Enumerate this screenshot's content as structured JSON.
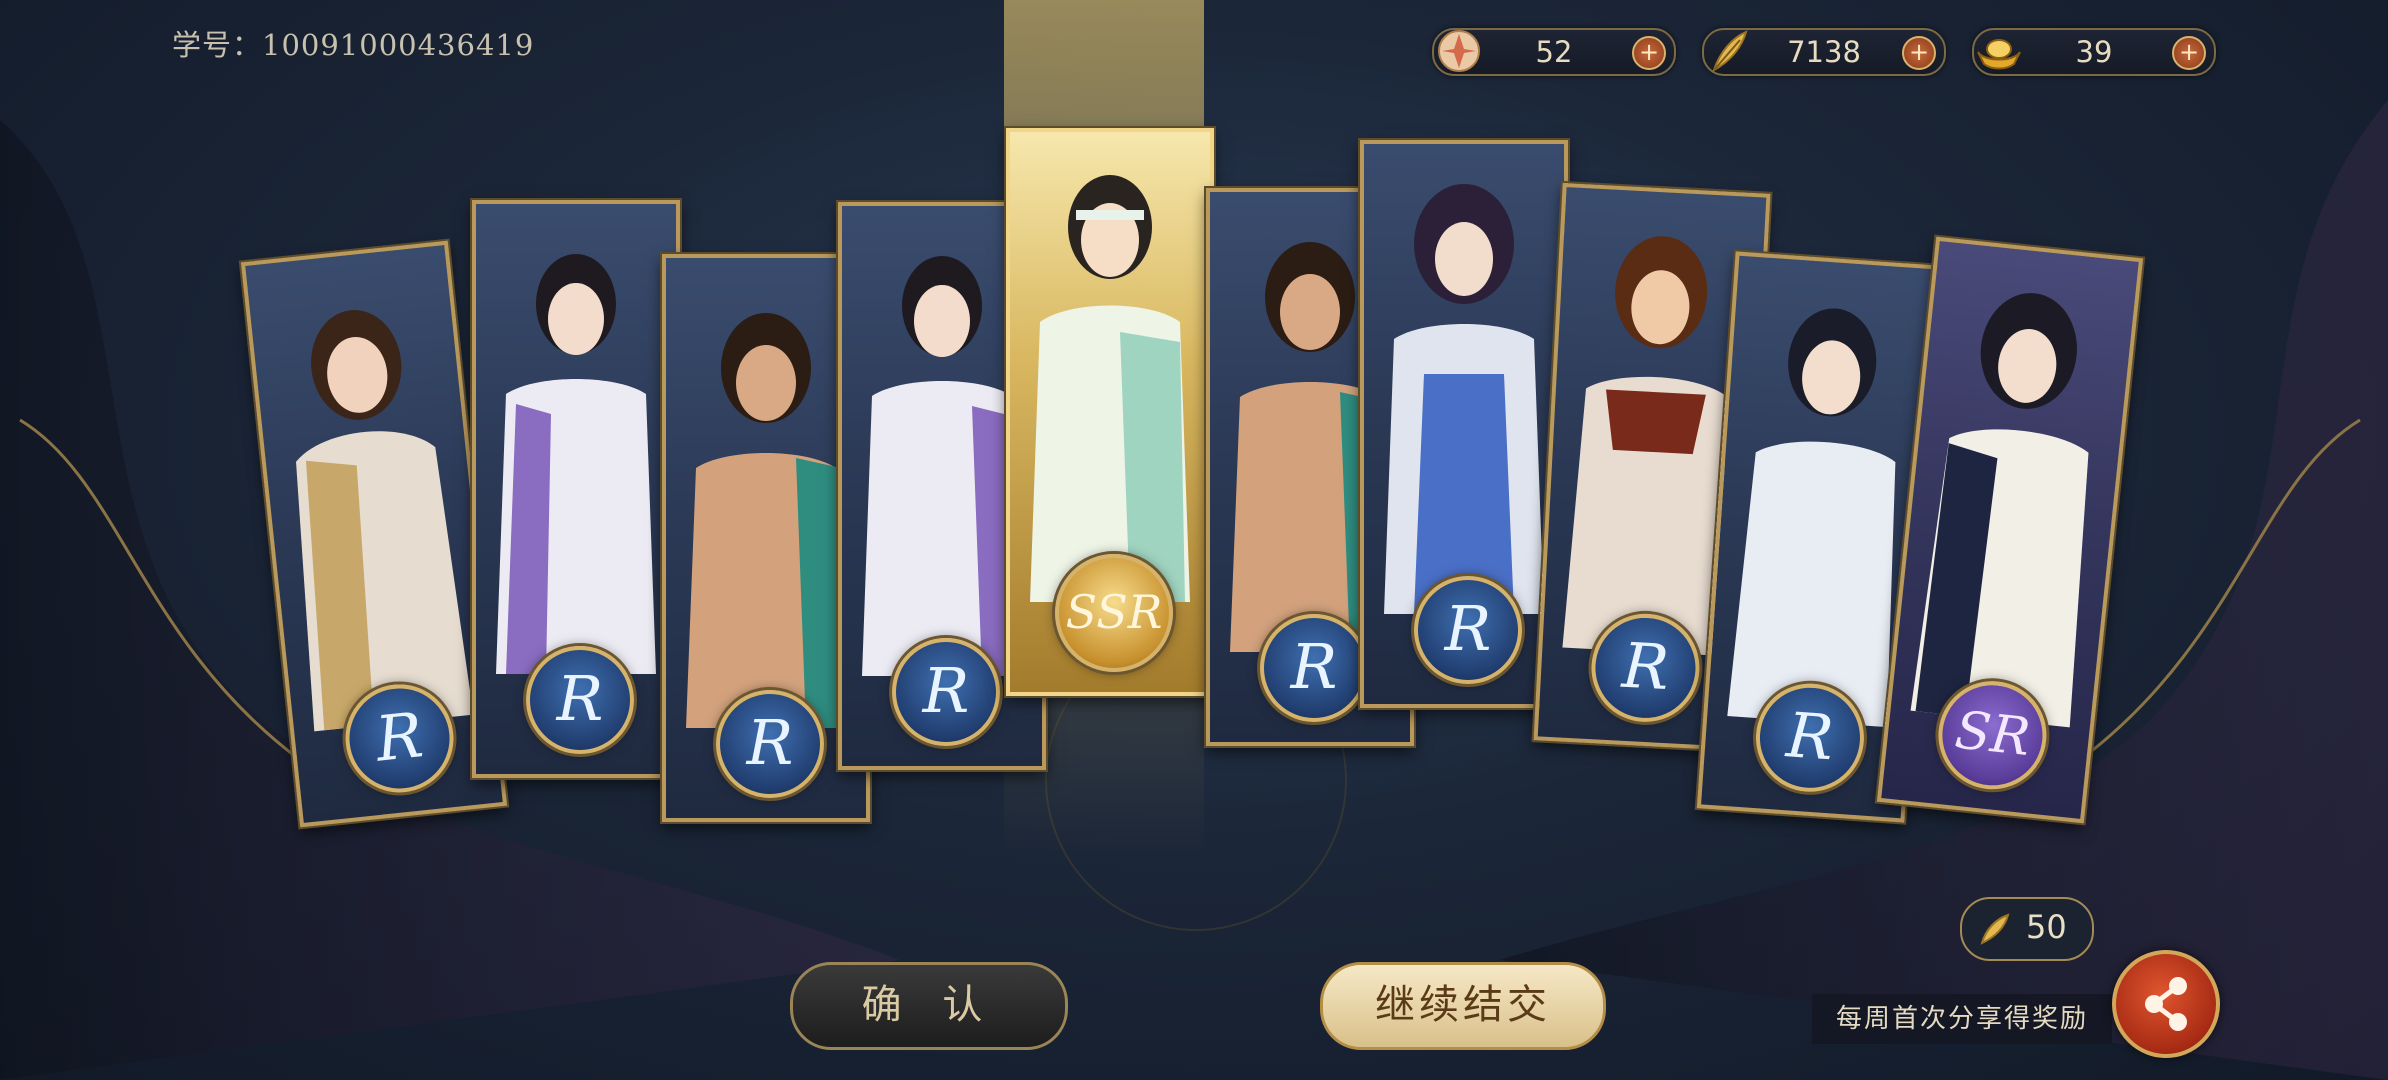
{
  "header": {
    "student_id": "学号：10091000436419"
  },
  "currencies": [
    {
      "icon": "fan-flower-icon",
      "value": "52",
      "plus": "+"
    },
    {
      "icon": "feather-icon",
      "value": "7138",
      "plus": "+"
    },
    {
      "icon": "gold-ingot-icon",
      "value": "39",
      "plus": "+"
    }
  ],
  "cards": [
    {
      "rarity": "R",
      "name": "card-1"
    },
    {
      "rarity": "R",
      "name": "card-2"
    },
    {
      "rarity": "R",
      "name": "card-3"
    },
    {
      "rarity": "R",
      "name": "card-4"
    },
    {
      "rarity": "SSR",
      "name": "card-5"
    },
    {
      "rarity": "R",
      "name": "card-6"
    },
    {
      "rarity": "R",
      "name": "card-7"
    },
    {
      "rarity": "R",
      "name": "card-8"
    },
    {
      "rarity": "R",
      "name": "card-9"
    },
    {
      "rarity": "SR",
      "name": "card-10"
    }
  ],
  "buttons": {
    "confirm": "确 认",
    "continue": "继续结交"
  },
  "share": {
    "reward_value": "50",
    "label": "每周首次分享得奖励"
  },
  "colors": {
    "gold_border": "#b99a5c",
    "ssr_gold": "#f1d68a",
    "share_red": "#c13a1c",
    "background": "#1b2638"
  }
}
